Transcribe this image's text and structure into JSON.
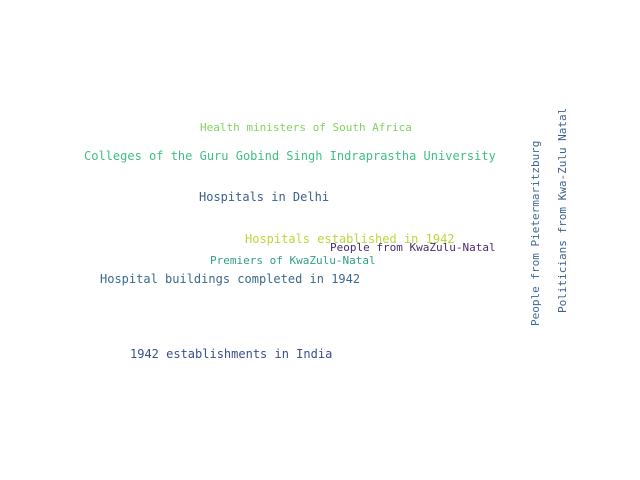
{
  "words": [
    {
      "text": "Health ministers of South Africa",
      "color": "#7fd35f"
    },
    {
      "text": "Colleges of the Guru Gobind Singh Indraprastha University",
      "color": "#3fbf84"
    },
    {
      "text": "Hospitals in Delhi",
      "color": "#3b5f91"
    },
    {
      "text": "Hospitals established in 1942",
      "color": "#b8d93a"
    },
    {
      "text": "People from KwaZulu-Natal",
      "color": "#4a2a6f"
    },
    {
      "text": "Premiers of KwaZulu-Natal",
      "color": "#2e9e88"
    },
    {
      "text": "Hospital buildings completed in 1942",
      "color": "#3b6a8e"
    },
    {
      "text": "1942 establishments in India",
      "color": "#3a4f8c"
    },
    {
      "text": "People from Pietermaritzburg",
      "color": "#3f6b94"
    },
    {
      "text": "Politicians from Kwa-Zulu Natal",
      "color": "#3c5f8c"
    }
  ]
}
